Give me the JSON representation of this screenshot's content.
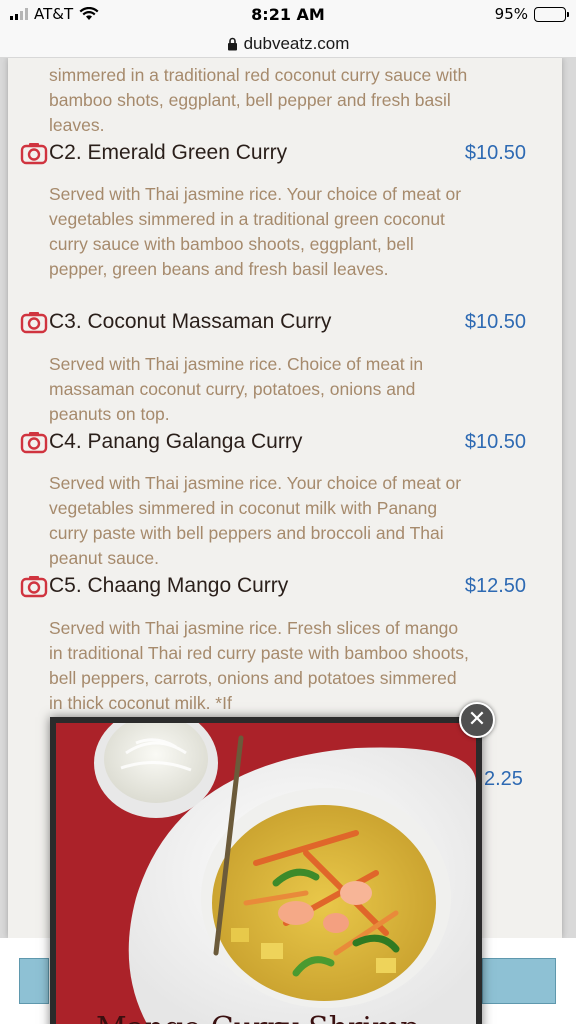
{
  "status_bar": {
    "carrier": "AT&T",
    "time": "8:21 AM",
    "battery": "95%",
    "battery_level": 0.95
  },
  "browser": {
    "url": "dubveatz.com"
  },
  "menu": {
    "top_desc": "simmered in a traditional red coconut curry sauce with bamboo shots, eggplant, bell pepper and fresh basil leaves.",
    "items": [
      {
        "name": "C2. Emerald Green Curry",
        "price": "$10.50",
        "desc": "Served with Thai jasmine rice. Your choice of meat or vegetables simmered in a traditional green coconut curry sauce with bamboo shoots, eggplant, bell pepper, green beans and fresh basil leaves."
      },
      {
        "name": "C3. Coconut Massaman Curry",
        "price": "$10.50",
        "desc": "Served with Thai jasmine rice. Choice of meat in massaman coconut curry, potatoes, onions and peanuts on top."
      },
      {
        "name": "C4. Panang Galanga Curry",
        "price": "$10.50",
        "desc": "Served with Thai jasmine rice. Your choice of meat or vegetables simmered in coconut milk with Panang curry paste with bell peppers and broccoli and Thai peanut sauce."
      },
      {
        "name": "C5. Chaang Mango Curry",
        "price": "$12.50",
        "desc": "Served with Thai jasmine rice. Fresh slices of mango in traditional Thai red curry paste with bamboo shoots, bell peppers, carrots, onions and potatoes simmered in thick coconut milk. *If"
      }
    ],
    "partial_price": "2.25"
  },
  "popup": {
    "caption": "Mango Curry Shrimp",
    "close_icon": "close-icon"
  },
  "colors": {
    "price": "#2e6ab3",
    "desc": "#a68a6c",
    "camera": "#d0343f",
    "button": "#8ec1d4"
  }
}
